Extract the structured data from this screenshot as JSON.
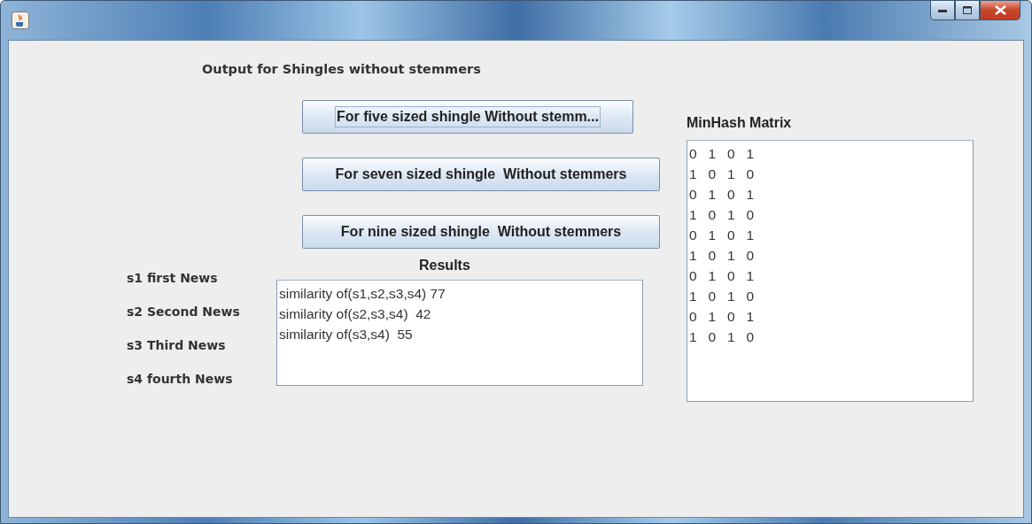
{
  "heading": "Output for Shingles without stemmers",
  "buttons": [
    {
      "label": "For five sized shingle Without stemm...",
      "focused": true
    },
    {
      "label": "For seven sized shingle  Without stemmers",
      "focused": false
    },
    {
      "label": "For nine sized shingle  Without stemmers",
      "focused": false
    }
  ],
  "results": {
    "title": "Results",
    "lines": [
      "similarity of(s1,s2,s3,s4) 77",
      "similarity of(s2,s3,s4)  42",
      "similarity of(s3,s4)  55"
    ]
  },
  "news_labels": [
    "s1 first News",
    "s2 Second News",
    "s3 Third News",
    "s4 fourth News"
  ],
  "minhash": {
    "title": "MinHash Matrix",
    "rows": [
      "0   1   0   1",
      "1   0   1   0",
      "0   1   0   1",
      "1   0   1   0",
      "0   1   0   1",
      "1   0   1   0",
      "0   1   0   1",
      "1   0   1   0",
      "0   1   0   1",
      "1   0   1   0"
    ]
  }
}
